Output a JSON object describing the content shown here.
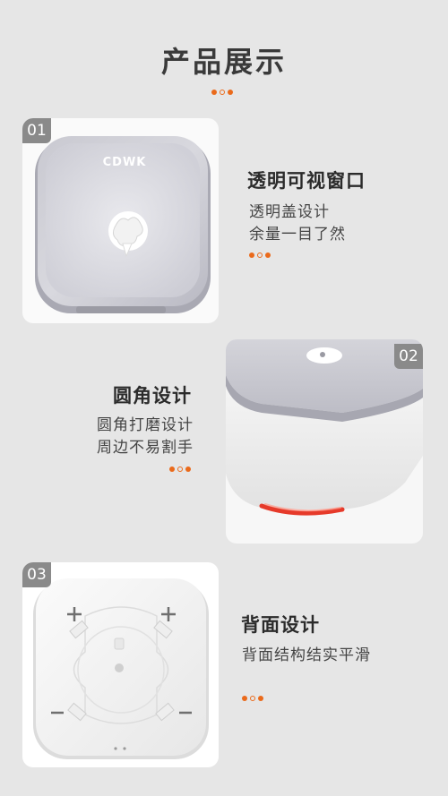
{
  "page_title": "产品展示",
  "features": [
    {
      "number": "01",
      "heading": "透明可视窗口",
      "lines": [
        "透明盖设计",
        "余量一目了然"
      ],
      "brand": "CDWK"
    },
    {
      "number": "02",
      "heading": "圆角设计",
      "lines": [
        "圆角打磨设计",
        "周边不易割手"
      ]
    },
    {
      "number": "03",
      "heading": "背面设计",
      "lines": [
        "背面结构结实平滑"
      ]
    }
  ],
  "colors": {
    "accent": "#ea6a1b",
    "background": "#e6e6e6",
    "badge": "#8a8a8a"
  }
}
